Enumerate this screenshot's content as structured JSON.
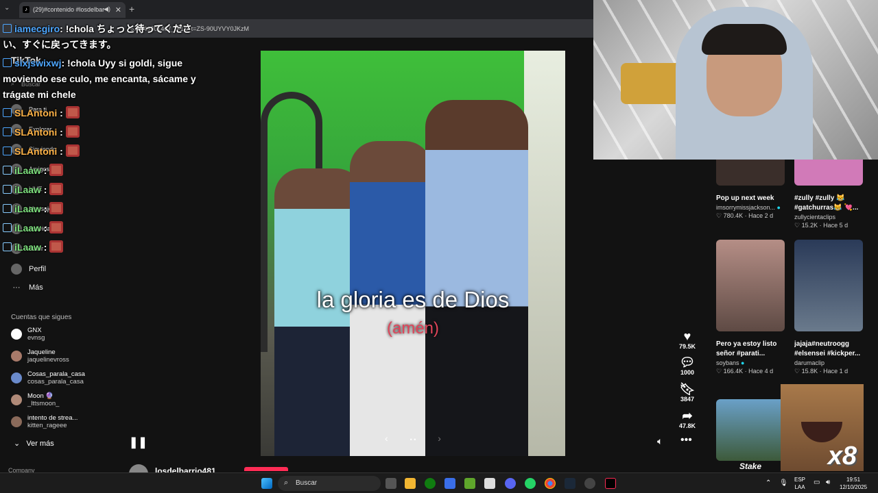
{
  "browser": {
    "tab_title": "(29)#contenido #losdelbar",
    "address": "671149601407_r=1&_t=ZS-90UYVY0JKzM",
    "new_tab": "+",
    "tab_close": "✕"
  },
  "chat": [
    {
      "user": "iamecgiro",
      "text": ": !chola ちょっと待ってくださ",
      "cont": "い、すぐに戻ってきます。",
      "user_color": "blue"
    },
    {
      "user": "sixjswixwj",
      "text": ": !chola Uyy si goldi, sigue",
      "cont": "moviendo ese culo, me encanta, sácame y",
      "cont2": "trágate mi chele",
      "user_color": "blue"
    },
    {
      "user": "SLAntoni",
      "text": " :",
      "user_color": "orange"
    },
    {
      "user": "SLAntoni",
      "text": " :",
      "user_color": "orange"
    },
    {
      "user": "SLAntoni",
      "text": " :",
      "user_color": "orange"
    },
    {
      "user": "iLaaw",
      "text": " :",
      "user_color": "green"
    },
    {
      "user": "iLaaw",
      "text": " :",
      "user_color": "green"
    },
    {
      "user": "iLaaw",
      "text": " :",
      "user_color": "green"
    },
    {
      "user": "iLaaw",
      "text": " :",
      "user_color": "green"
    },
    {
      "user": "iLaaw",
      "text": " :",
      "user_color": "green"
    }
  ],
  "sidebar": {
    "logo": "TikTok",
    "search_placeholder": "Buscar",
    "nav": [
      {
        "label": "Para ti"
      },
      {
        "label": "Explorar"
      },
      {
        "label": "Siguiendo"
      },
      {
        "label": "Amigos"
      },
      {
        "label": "LIVE"
      },
      {
        "label": "Mensajes"
      },
      {
        "label": "Actividad"
      },
      {
        "label": "Subir"
      },
      {
        "label": "Perfil"
      },
      {
        "label": "Más"
      }
    ],
    "following_title": "Cuentas que sigues",
    "following": [
      {
        "name": "GNX",
        "handle": "evnsg"
      },
      {
        "name": "Jaqueline",
        "handle": "jaquelinevross"
      },
      {
        "name": "Cosas_parala_casa",
        "handle": "cosas_parala_casa"
      },
      {
        "name": "Moon 🔮",
        "handle": "_lttsmoon_"
      },
      {
        "name": "intento de strea...",
        "handle": "kitten_rageee"
      }
    ],
    "see_more": "Ver más",
    "company": "Company"
  },
  "video": {
    "caption_main": "la gloria es de Dios",
    "caption_sub": "(amén)",
    "author": "losdelbarrio481",
    "prev": "‹",
    "next": "›",
    "dots": "• •"
  },
  "actions": {
    "likes": "79.5K",
    "comments": "1000",
    "saves": "3847",
    "shares": "47.8K"
  },
  "recommendations": [
    {
      "title": "Pop up next week",
      "author": "imsorrymissjackson...",
      "verified": true,
      "likes": "780.4K",
      "date": "Hace 2 d"
    },
    {
      "title": "#zully #zully 😹 #gatchurras😹 💘...",
      "author": "zullycientaclips",
      "verified": false,
      "likes": "15.2K",
      "date": "Hace 5 d"
    },
    {
      "title": "Pero ya estoy listo señor #parati...",
      "author": "soybans",
      "verified": true,
      "likes": "166.4K",
      "date": "Hace 4 d"
    },
    {
      "title": "jajaja#neutroogg #elsensei #kickper...",
      "author": "darumaclip",
      "verified": false,
      "likes": "15.8K",
      "date": "Hace 1 d"
    }
  ],
  "overlay": {
    "meme_text": "x8",
    "stake": "Stake"
  },
  "taskbar": {
    "search": "Buscar",
    "lang1": "ESP",
    "lang2": "LAA",
    "time": "19:51",
    "date": "12/10/2025"
  },
  "colors": {
    "tiktok_red": "#fe2c55",
    "chat_blue": "#4da6ff",
    "chat_orange": "#ffb347",
    "chat_green": "#7de07d"
  }
}
